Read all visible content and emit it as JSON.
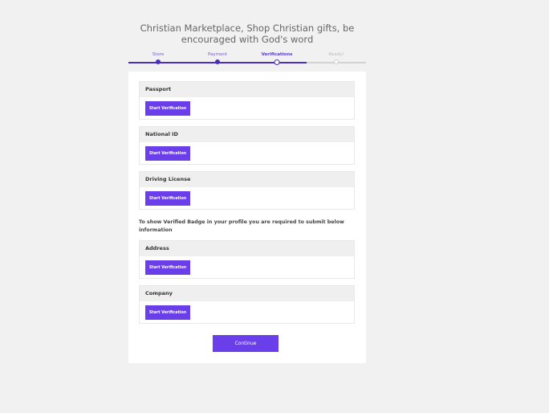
{
  "header": {
    "title": "Christian Marketplace, Shop Christian gifts, be encouraged with God's word"
  },
  "stepper": {
    "steps": [
      {
        "label": "Store",
        "state": "done"
      },
      {
        "label": "Payment",
        "state": "done"
      },
      {
        "label": "Verifications",
        "state": "current"
      },
      {
        "label": "Ready!",
        "state": "pending"
      }
    ]
  },
  "verifications": {
    "sections": [
      {
        "title": "Passport",
        "button": "Start Verification"
      },
      {
        "title": "National ID",
        "button": "Start Verification"
      },
      {
        "title": "Driving License",
        "button": "Start Verification"
      }
    ],
    "badge_notice": "To show Verified Badge in your profile you are required to submit below information",
    "badge_sections": [
      {
        "title": "Address",
        "button": "Start Verification"
      },
      {
        "title": "Company",
        "button": "Start Verification"
      }
    ],
    "continue_label": "Continue"
  },
  "colors": {
    "accent": "#6a3fea",
    "stepper_active": "#4a2ebd",
    "background": "#f1f1f1"
  }
}
